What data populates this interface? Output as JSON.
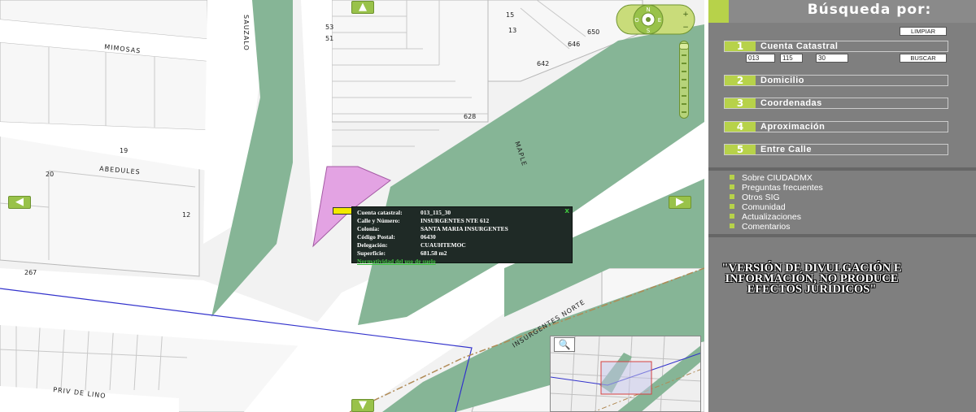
{
  "map": {
    "streets": {
      "mimosas": "MIMOSAS",
      "sauzalo": "SAUZALO",
      "abedules": "ABEDULES",
      "maple": "MAPLE",
      "insurgentes_norte": "INSURGENTES NORTE",
      "priv_de_lino": "PRIV DE LINO"
    },
    "lot_numbers": {
      "n53": "53",
      "n51": "51",
      "n15": "15",
      "n13": "13",
      "n650": "650",
      "n646": "646",
      "n642": "642",
      "n628": "628",
      "n19": "19",
      "n20": "20",
      "n12": "12",
      "n267": "267"
    },
    "pan_icons": {
      "up": "▲",
      "down": "▼",
      "left": "◀",
      "right": "▶"
    },
    "compass": {
      "n": "N",
      "s": "S",
      "e": "E",
      "o": "O",
      "plus": "+",
      "minus": "−"
    },
    "colors": {
      "green_area": "#86b596",
      "selected_lot": "#e3a3e3",
      "street_line": "#3333cc",
      "accent": "#b7d24a"
    }
  },
  "info": {
    "rows": [
      {
        "k": "Cuenta catastral:",
        "v": "013_115_30"
      },
      {
        "k": "Calle y Número:",
        "v": "INSURGENTES NTE 612"
      },
      {
        "k": "Colonia:",
        "v": "SANTA MARIA INSURGENTES"
      },
      {
        "k": "Código Postal:",
        "v": "06430"
      },
      {
        "k": "Delegación:",
        "v": "CUAUHTEMOC"
      },
      {
        "k": "Superficie:",
        "v": "681.58 m2"
      }
    ],
    "link": "Normatividad del uso de suelo",
    "close": "x"
  },
  "overview": {
    "zoom_icon": "🔍"
  },
  "panel": {
    "title": "Búsqueda por:",
    "limpiar": "LIMPIAR",
    "buscar": "BUSCAR",
    "cuenta_inputs": [
      "013",
      "115",
      "30"
    ],
    "search_options": [
      {
        "num": "1",
        "label": "Cuenta Catastral"
      },
      {
        "num": "2",
        "label": "Domicilio"
      },
      {
        "num": "3",
        "label": "Coordenadas"
      },
      {
        "num": "4",
        "label": "Aproximación"
      },
      {
        "num": "5",
        "label": "Entre Calle"
      }
    ],
    "links": [
      "Sobre CIUDADMX",
      "Preguntas frecuentes",
      "Otros SIG",
      "Comunidad",
      "Actualizaciones",
      "Comentarios"
    ],
    "disclaimer": "\"VERSIÓN DE DIVULGACIÓN E INFORMACIÓN, NO PRODUCE EFECTOS JURÍDICOS\""
  }
}
